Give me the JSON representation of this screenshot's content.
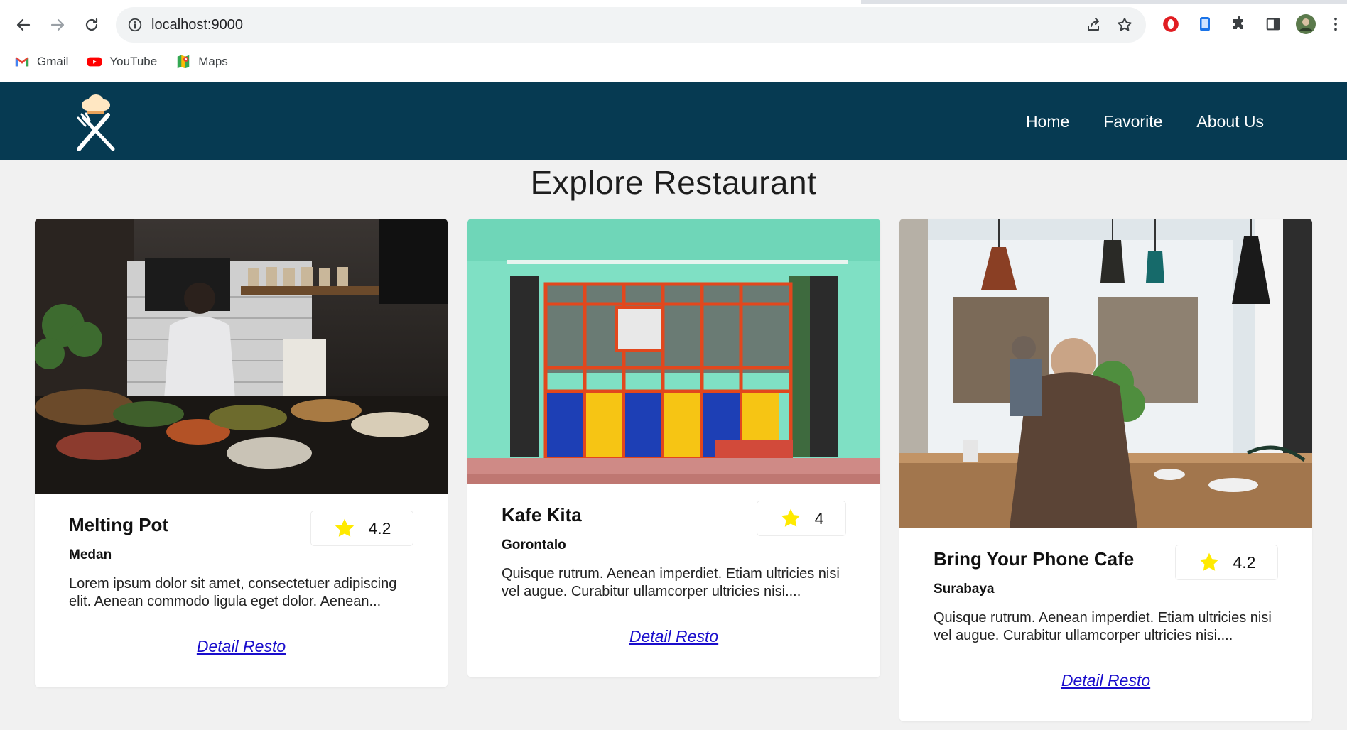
{
  "browser": {
    "url": "localhost:9000",
    "bookmarks": [
      {
        "label": "Gmail",
        "icon": "gmail-icon"
      },
      {
        "label": "YouTube",
        "icon": "youtube-icon"
      },
      {
        "label": "Maps",
        "icon": "maps-icon"
      }
    ]
  },
  "header": {
    "logo": "chef-hat-fork-knife-logo",
    "nav": [
      "Home",
      "Favorite",
      "About Us"
    ],
    "background": "#063a52"
  },
  "main": {
    "title": "Explore Restaurant",
    "detail_label": "Detail Resto",
    "restaurants": [
      {
        "name": "Melting Pot",
        "city": "Medan",
        "rating": "4.2",
        "description": "Lorem ipsum dolor sit amet, consectetuer adipiscing elit. Aenean commodo ligula eget dolor. Aenean...",
        "photo": "cafe counter with chef and food display"
      },
      {
        "name": "Kafe Kita",
        "city": "Gorontalo",
        "rating": "4",
        "description": "Quisque rutrum. Aenean imperdiet. Etiam ultricies nisi vel augue. Curabitur ullamcorper ultricies nisi....",
        "photo": "turquoise shopfront with colorful window"
      },
      {
        "name": "Bring Your Phone Cafe",
        "city": "Surabaya",
        "rating": "4.2",
        "description": "Quisque rutrum. Aenean imperdiet. Etiam ultricies nisi vel augue. Curabitur ullamcorper ultricies nisi....",
        "photo": "old man sitting in cafe with pendant lamps"
      }
    ]
  },
  "colors": {
    "star": "#ffea00",
    "link": "#1a0dcc",
    "page_bg": "#f1f1f1"
  }
}
